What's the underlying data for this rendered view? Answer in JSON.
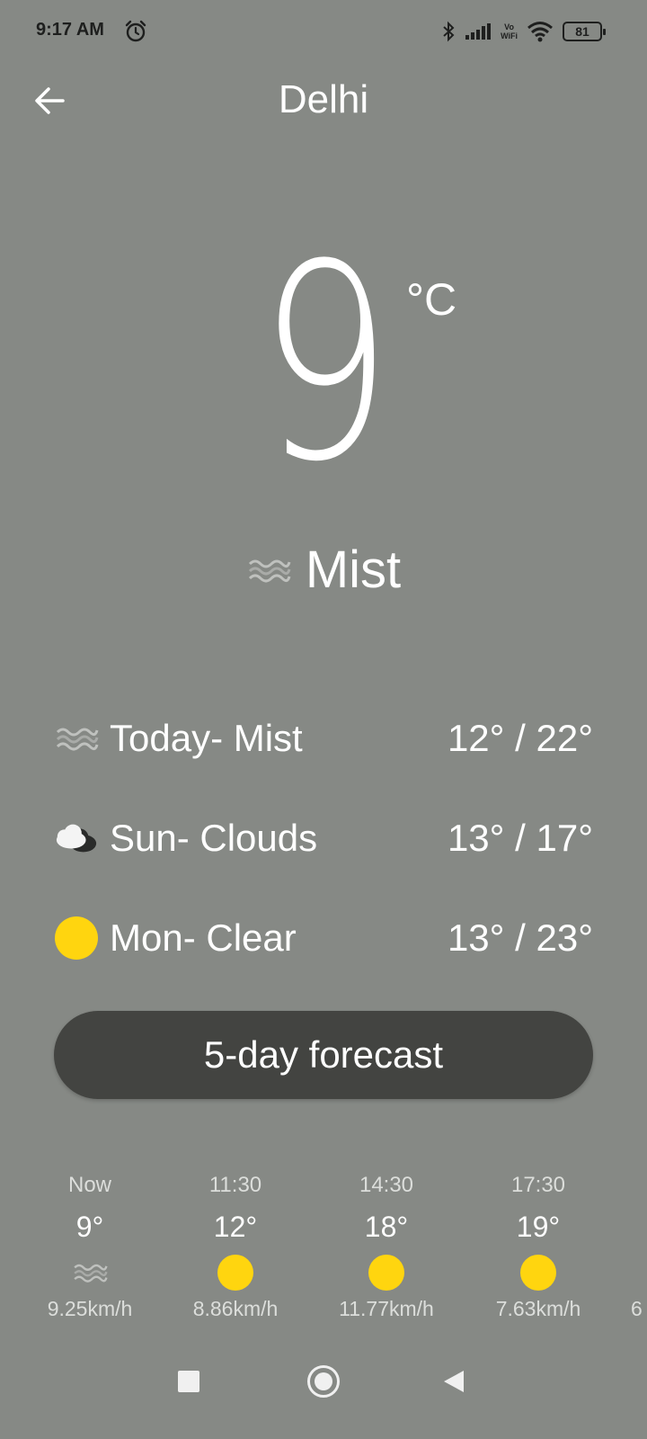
{
  "status_bar": {
    "time": "9:17 AM",
    "vowifi_top": "Vo",
    "vowifi_bottom": "WiFi",
    "battery": "81"
  },
  "header": {
    "city": "Delhi"
  },
  "current": {
    "temperature": "9",
    "unit": "°C",
    "condition": "Mist",
    "condition_icon": "mist-icon"
  },
  "daily": [
    {
      "label": "Today- Mist",
      "range": "12° / 22°",
      "icon": "mist-icon"
    },
    {
      "label": "Sun- Clouds",
      "range": "13° / 17°",
      "icon": "clouds-icon"
    },
    {
      "label": "Mon- Clear",
      "range": "13° / 23°",
      "icon": "sun-icon"
    }
  ],
  "forecast_button": {
    "label": "5-day forecast"
  },
  "hourly": [
    {
      "time": "Now",
      "temp": "9°",
      "icon": "mist-icon",
      "wind": "9.25km/h"
    },
    {
      "time": "11:30",
      "temp": "12°",
      "icon": "sun-icon",
      "wind": "8.86km/h"
    },
    {
      "time": "14:30",
      "temp": "18°",
      "icon": "sun-icon",
      "wind": "11.77km/h"
    },
    {
      "time": "17:30",
      "temp": "19°",
      "icon": "sun-icon",
      "wind": "7.63km/h"
    },
    {
      "time": "",
      "temp": "",
      "icon": "",
      "wind": "6"
    }
  ],
  "colors": {
    "background": "#868985",
    "button": "#434441",
    "sun": "#FFD50F"
  }
}
